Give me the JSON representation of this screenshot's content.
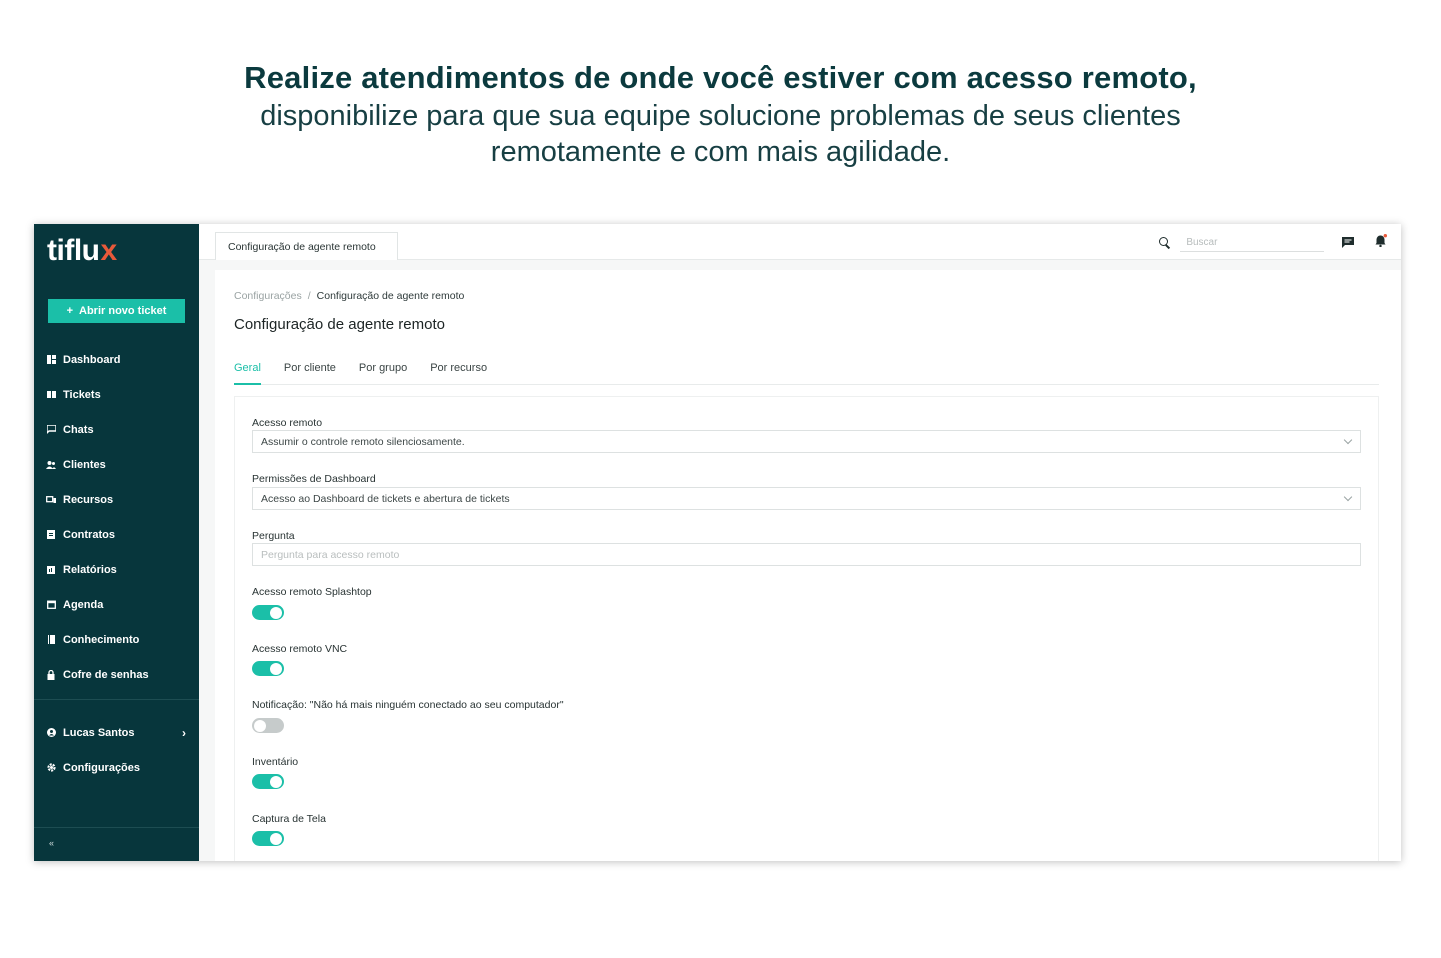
{
  "headline": {
    "line1": "Realize atendimentos de onde você estiver com acesso remoto,",
    "line2": "disponibilize para que sua equipe solucione problemas de seus clientes",
    "line3": "remotamente e com mais agilidade."
  },
  "sidebar": {
    "logo_main": "tiflu",
    "logo_accent": "x",
    "new_ticket_label": "Abrir novo ticket",
    "items": [
      {
        "label": "Dashboard",
        "icon": "dashboard-icon"
      },
      {
        "label": "Tickets",
        "icon": "tickets-icon"
      },
      {
        "label": "Chats",
        "icon": "chat-icon"
      },
      {
        "label": "Clientes",
        "icon": "clients-icon"
      },
      {
        "label": "Recursos",
        "icon": "resources-icon"
      },
      {
        "label": "Contratos",
        "icon": "contracts-icon"
      },
      {
        "label": "Relatórios",
        "icon": "reports-icon"
      },
      {
        "label": "Agenda",
        "icon": "calendar-icon"
      },
      {
        "label": "Conhecimento",
        "icon": "book-icon"
      },
      {
        "label": "Cofre de senhas",
        "icon": "lock-icon"
      }
    ],
    "user_name": "Lucas Santos",
    "settings_label": "Configurações",
    "collapse_glyph": "«"
  },
  "topbar": {
    "page_tab": "Configuração de agente remoto",
    "search_placeholder": "Buscar"
  },
  "breadcrumb": {
    "parent": "Configurações",
    "separator": "/",
    "current": "Configuração de agente remoto"
  },
  "page_title": "Configuração de agente remoto",
  "tabs": [
    "Geral",
    "Por cliente",
    "Por grupo",
    "Por recurso"
  ],
  "active_tab": "Geral",
  "form": {
    "remote_access": {
      "label": "Acesso remoto",
      "value": "Assumir o controle remoto silenciosamente."
    },
    "dashboard_permissions": {
      "label": "Permissões de Dashboard",
      "value": "Acesso ao Dashboard de tickets e abertura de tickets"
    },
    "question": {
      "label": "Pergunta",
      "placeholder": "Pergunta para acesso remoto"
    },
    "toggles": [
      {
        "label": "Acesso remoto Splashtop",
        "on": true
      },
      {
        "label": "Acesso remoto VNC",
        "on": true
      },
      {
        "label": "Notificação: \"Não há mais ninguém conectado ao seu computador\"",
        "on": false
      },
      {
        "label": "Inventário",
        "on": true
      },
      {
        "label": "Captura de Tela",
        "on": true
      }
    ]
  },
  "colors": {
    "sidebar_bg": "#07363c",
    "accent": "#1bbfa8",
    "logo_accent": "#e8593a",
    "headline": "#0b3a3e"
  }
}
